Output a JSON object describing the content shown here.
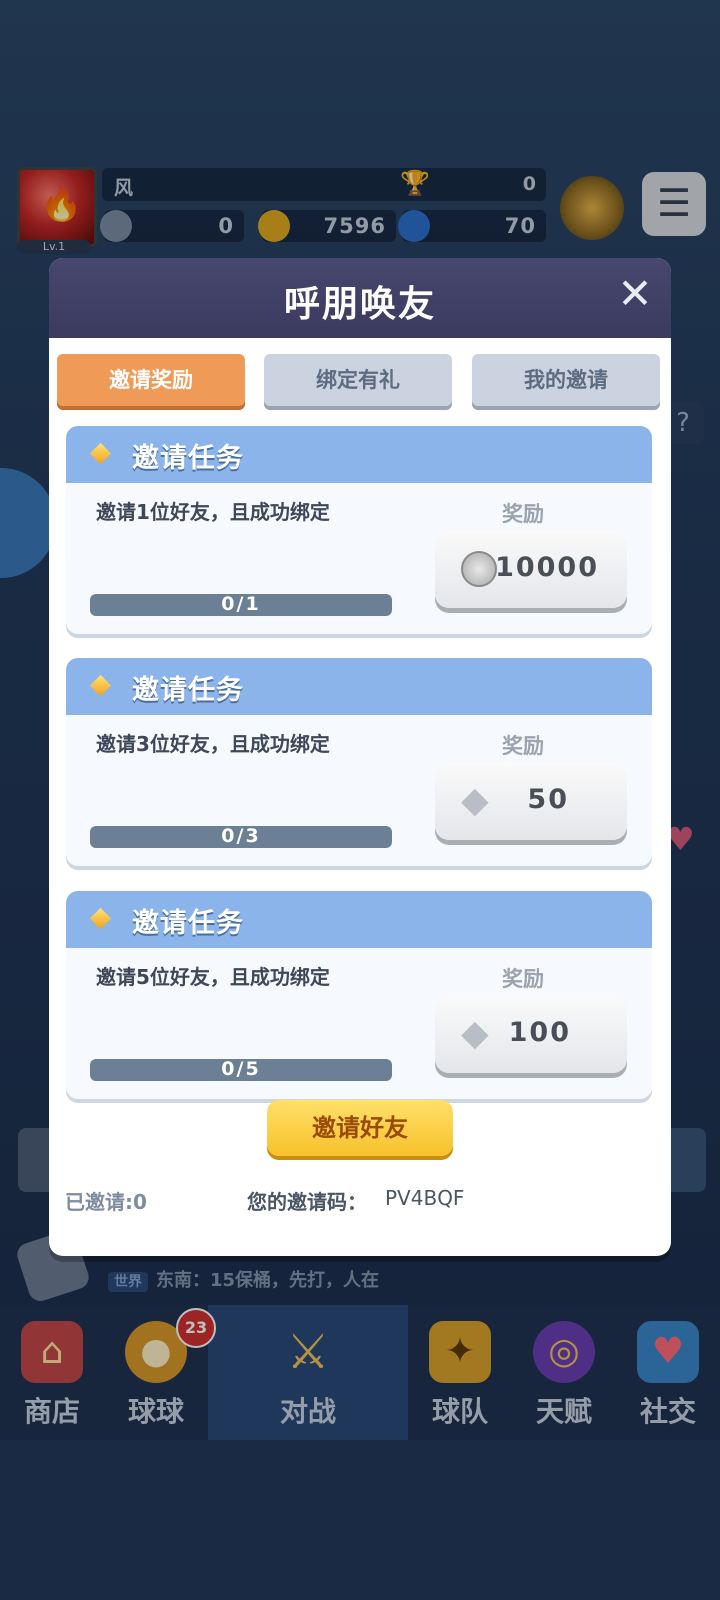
{
  "hud": {
    "level": "Lv.1",
    "player_name": "风",
    "trophies": "0",
    "stamina": "0",
    "coins": "7596",
    "gems": "70"
  },
  "chat": {
    "channel": "世界",
    "message": "东南：15保桶，先打，人在"
  },
  "nav": {
    "badge_count": "23",
    "items": [
      {
        "label": "商店"
      },
      {
        "label": "球球"
      },
      {
        "label": "对战"
      },
      {
        "label": "球队"
      },
      {
        "label": "天赋"
      },
      {
        "label": "社交"
      }
    ]
  },
  "modal": {
    "title": "呼朋唤友",
    "tabs": [
      {
        "label": "邀请奖励",
        "active": true
      },
      {
        "label": "绑定有礼",
        "active": false
      },
      {
        "label": "我的邀请",
        "active": false
      }
    ],
    "tasks": [
      {
        "title": "邀请任务",
        "description": "邀请1位好友，且成功绑定",
        "reward_label": "奖励",
        "reward_icon": "silver-coin-icon",
        "reward_value": "10000",
        "progress_text": "0/1",
        "progress": 0
      },
      {
        "title": "邀请任务",
        "description": "邀请3位好友，且成功绑定",
        "reward_label": "奖励",
        "reward_icon": "diamond-icon",
        "reward_value": "50",
        "progress_text": "0/3",
        "progress": 0
      },
      {
        "title": "邀请任务",
        "description": "邀请5位好友，且成功绑定",
        "reward_label": "奖励",
        "reward_icon": "diamond-icon",
        "reward_value": "100",
        "progress_text": "0/5",
        "progress": 0
      }
    ],
    "invite_button": "邀请好友",
    "invited_count": "已邀请:0",
    "invite_code_label": "您的邀请码：",
    "invite_code": "PV4BQF"
  },
  "colors": {
    "modal_header": "#3b3b60",
    "active_tab": "#f09a57",
    "card_header": "#8ab4ea",
    "invite_button": "#f7c12a",
    "progress_track": "#6b7f95"
  }
}
